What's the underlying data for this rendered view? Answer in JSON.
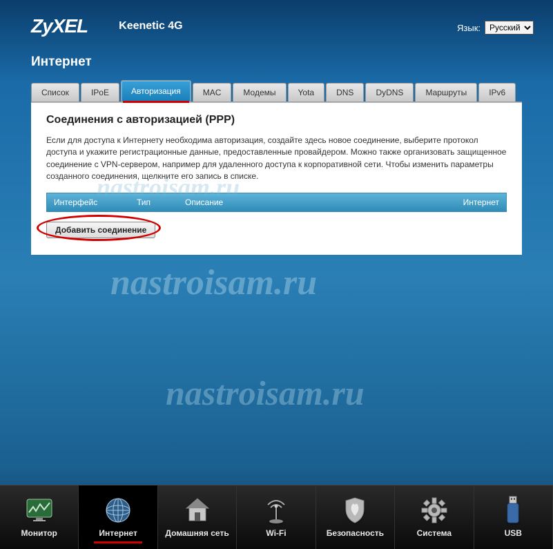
{
  "brand": "ZyXEL",
  "model": "Keenetic 4G",
  "language_label": "Язык:",
  "language_value": "Русский",
  "section": "Интернет",
  "tabs": {
    "t0": "Список",
    "t1": "IPoE",
    "t2": "Авторизация",
    "t3": "MAC",
    "t4": "Модемы",
    "t5": "Yota",
    "t6": "DNS",
    "t7": "DyDNS",
    "t8": "Маршруты",
    "t9": "IPv6"
  },
  "panel": {
    "title": "Соединения с авторизацией (PPP)",
    "description": "Если для доступа к Интернету необходима авторизация, создайте здесь новое соединение, выберите протокол доступа и укажите регистрационные данные, предоставленные провайдером. Можно также организовать защищенное соединение с VPN-сервером, например для удаленного доступа к корпоративной сети. Чтобы изменить параметры созданного соединения, щелкните его запись в списке.",
    "columns": {
      "iface": "Интерфейс",
      "type": "Тип",
      "desc": "Описание",
      "inet": "Интернет"
    },
    "add_label": "Добавить соединение"
  },
  "watermark": "nastroisam.ru",
  "bottom": {
    "b0": "Монитор",
    "b1": "Интернет",
    "b2": "Домашняя сеть",
    "b3": "Wi-Fi",
    "b4": "Безопасность",
    "b5": "Система",
    "b6": "USB"
  }
}
